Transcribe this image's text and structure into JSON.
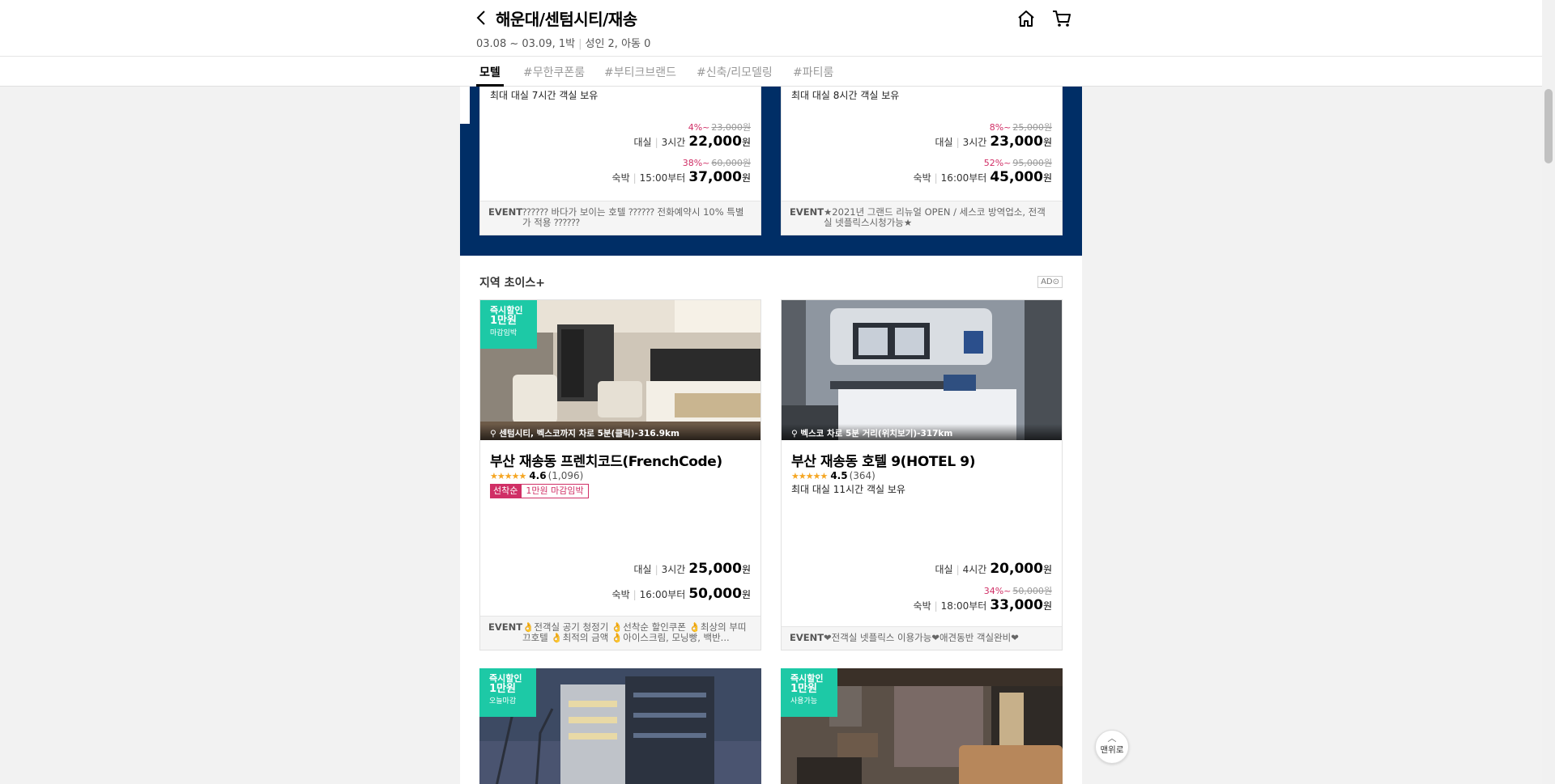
{
  "header": {
    "title": "해운대/센텀시티/재송",
    "dates": "03.08 ~ 03.09, 1박",
    "guests": "성인 2, 아동 0"
  },
  "tabs": [
    {
      "label": "모텔"
    },
    {
      "label": "#무한쿠폰룸"
    },
    {
      "label": "#부티크브랜드"
    },
    {
      "label": "#신축/리모델링"
    },
    {
      "label": "#파티룸"
    }
  ],
  "top_cards": [
    {
      "availability": "최대 대실 7시간 객실 보유",
      "rental": {
        "discount": "4%~",
        "original": "23,000원",
        "label": "대실",
        "detail": "3시간",
        "price": "22,000",
        "unit": "원"
      },
      "stay": {
        "discount": "38%~",
        "original": "60,000원",
        "label": "숙박",
        "detail": "15:00부터",
        "price": "37,000",
        "unit": "원"
      },
      "event_label": "EVENT",
      "event_text": "⁇⁇⁇ 바다가 보이는 호텔 ⁇⁇⁇ 전화예약시 10% 특별가 적용 ⁇⁇⁇"
    },
    {
      "availability": "최대 대실 8시간 객실 보유",
      "rental": {
        "discount": "8%~",
        "original": "25,000원",
        "label": "대실",
        "detail": "3시간",
        "price": "23,000",
        "unit": "원"
      },
      "stay": {
        "discount": "52%~",
        "original": "95,000원",
        "label": "숙박",
        "detail": "16:00부터",
        "price": "45,000",
        "unit": "원"
      },
      "event_label": "EVENT",
      "event_text": "★2021년 그랜드 리뉴얼 OPEN / 세스코 방역업소, 전객실 넷플릭스시청가능★"
    }
  ],
  "section": {
    "title": "지역 초이스+",
    "ad": "AD⊙"
  },
  "choice_cards": [
    {
      "badge": {
        "line1": "즉시할인",
        "line2": "1만원",
        "line3": "마감임박"
      },
      "location": "센텀시티, 벡스코까지 차로 5분(클릭)-316.9km",
      "name": "부산 재송동 프렌치코드(FrenchCode)",
      "stars": "★★★★★",
      "score": "4.6",
      "reviews": "(1,096)",
      "coupon_tag": "선착순",
      "coupon_text": "1만원 마감임박",
      "rental": {
        "label": "대실",
        "detail": "3시간",
        "price": "25,000",
        "unit": "원"
      },
      "stay": {
        "label": "숙박",
        "detail": "16:00부터",
        "price": "50,000",
        "unit": "원"
      },
      "event_label": "EVENT",
      "event_text": "👌전객실 공기 청정기 👌선착순 할인쿠폰 👌최상의 부띠끄호텔 👌최적의 금액 👌아이스크림, 모닝빵, 백반..."
    },
    {
      "location": "벡스코 차로 5분 거리(위치보기)-317km",
      "name": "부산 재송동 호텔 9(HOTEL 9)",
      "stars": "★★★★★",
      "score": "4.5",
      "reviews": "(364)",
      "availability": "최대 대실 11시간 객실 보유",
      "rental": {
        "label": "대실",
        "detail": "4시간",
        "price": "20,000",
        "unit": "원"
      },
      "stay": {
        "discount": "34%~",
        "original": "50,000원",
        "label": "숙박",
        "detail": "18:00부터",
        "price": "33,000",
        "unit": "원"
      },
      "event_label": "EVENT",
      "event_text": "❤전객실 넷플릭스 이용가능❤애견동반 객실완비❤"
    }
  ],
  "bottom_cards": [
    {
      "badge": {
        "line1": "즉시할인",
        "line2": "1만원",
        "line3": "오늘마감"
      }
    },
    {
      "badge": {
        "line1": "즉시할인",
        "line2": "1만원",
        "line3": "사용가능"
      }
    }
  ],
  "scroll_top": {
    "label": "맨위로"
  }
}
